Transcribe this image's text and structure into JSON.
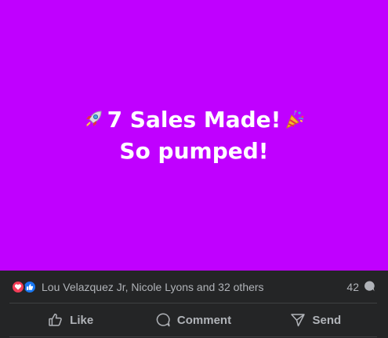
{
  "post": {
    "background_color": "#c000ff",
    "line1": "7 Sales Made!",
    "line2": "So pumped!",
    "emoji_left": "rocket-icon",
    "emoji_right": "party-popper-icon"
  },
  "reactions": {
    "icons": [
      "love-icon",
      "like-icon"
    ],
    "summary": "Lou Velazquez Jr, Nicole Lyons and 32 others",
    "comment_count": "42"
  },
  "actions": {
    "like_label": "Like",
    "comment_label": "Comment",
    "send_label": "Send"
  },
  "colors": {
    "love": "#f33e58",
    "like": "#1877f2",
    "footer_bg": "#242526",
    "secondary_text": "#b0b3b8"
  }
}
